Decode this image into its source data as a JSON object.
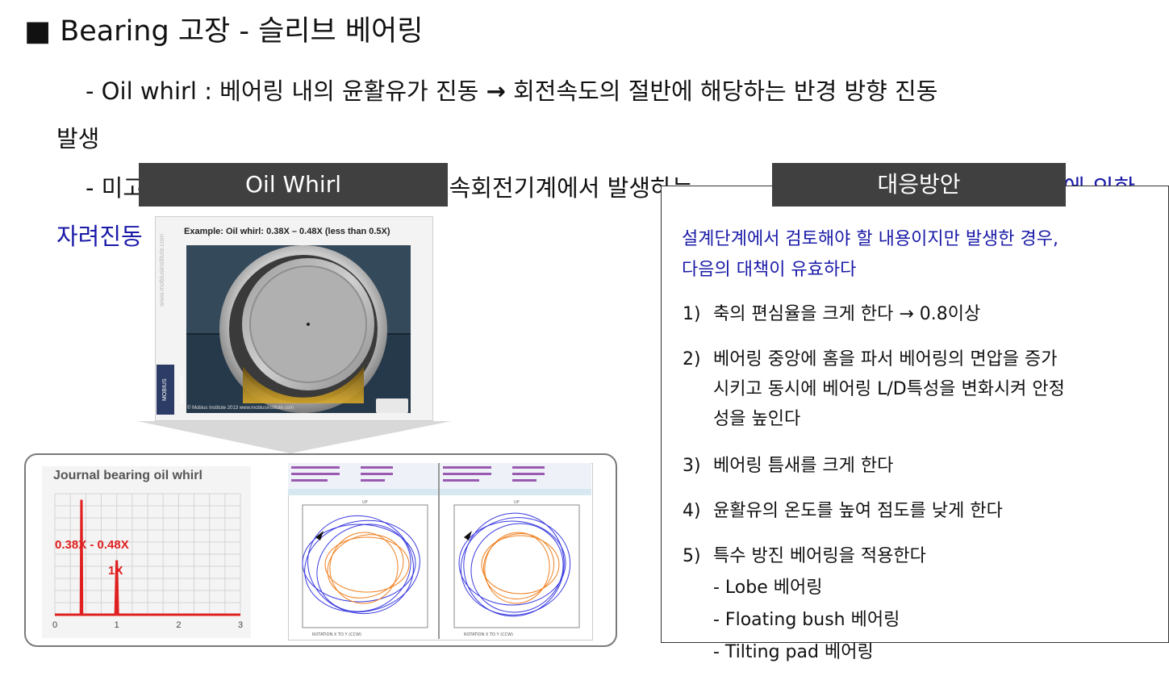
{
  "slide": {
    "title": "■ Bearing 고장 - 슬리브 베어링",
    "line1a": "- Oil whirl : 베어링 내의 윤활유가 진동 ",
    "arrow": "→",
    "line1b": " 회전속도의 절반에 해당하는 반경 방향 진동",
    "line2": "발생",
    "line3_left": "- 미고",
    "line3_mid": "고속회전기계에서 발생하는",
    "line3_right": "에 의한",
    "line4_left": "자려진동"
  },
  "left_panel": {
    "header": "Oil Whirl",
    "video_caption": "Example: Oil whirl: 0.38X – 0.48X (less than 0.5X)",
    "watermark": "www.mobiusinstitute.com",
    "logo_text": "MOBIUS INSTITUTE",
    "footer_text": "© Mobius Institute 2013  www.mobiusinstitute.com"
  },
  "spectrum": {
    "title": "Journal bearing oil whirl",
    "label_band": "0.38X - 0.48X",
    "label_1x": "1X",
    "x_ticks": [
      "0",
      "1",
      "2",
      "3"
    ]
  },
  "orbit": {
    "caption_a": "ROTATION X TO Y (CCW)",
    "caption_b": "ROTATION X TO Y (CCW)",
    "up_label": "UP"
  },
  "chart_data": {
    "type": "line",
    "title": "Journal bearing oil whirl",
    "xlabel": "",
    "ylabel": "",
    "xlim": [
      0,
      3
    ],
    "x_ticks": [
      0,
      1,
      2,
      3
    ],
    "series": [
      {
        "x": [
          0,
          0.42,
          0.43,
          0.44,
          0.98,
          1.0,
          1.02,
          3
        ],
        "values": [
          0,
          0,
          0.95,
          0,
          0,
          0.45,
          0,
          0
        ]
      }
    ],
    "annotations": [
      "0.38X - 0.48X",
      "1X"
    ],
    "grid": true,
    "color": "#e02020"
  },
  "right_panel": {
    "header": "대응방안",
    "intro_l1": "설계단계에서 검토해야 할 내용이지만 발생한 경우,",
    "intro_l2": "다음의 대책이 유효하다",
    "items": [
      {
        "num": "1)",
        "lines": [
          "축의 편심율을 크게 한다 → 0.8이상"
        ]
      },
      {
        "num": "2)",
        "lines": [
          "베어링 중앙에 홈을 파서 베어링의 면압을 증가",
          "시키고 동시에 베어링 L/D특성을 변화시켜 안정",
          "성을 높인다"
        ]
      },
      {
        "num": "3)",
        "lines": [
          "베어링 틈새를 크게 한다"
        ]
      },
      {
        "num": "4)",
        "lines": [
          "윤활유의 온도를 높여 점도를 낮게 한다"
        ]
      },
      {
        "num": "5)",
        "lines": [
          "특수 방진 베어링을 적용한다"
        ]
      }
    ],
    "sub_items": [
      "- Lobe 베어링",
      "- Floating bush 베어링",
      "- Tilting pad 베어링"
    ]
  },
  "colors": {
    "header_bg": "#404040",
    "blue_text": "#1a1aa8",
    "spectrum_red": "#e02020",
    "orbit_blue": "#3a3ae0",
    "orbit_orange": "#f08020"
  }
}
